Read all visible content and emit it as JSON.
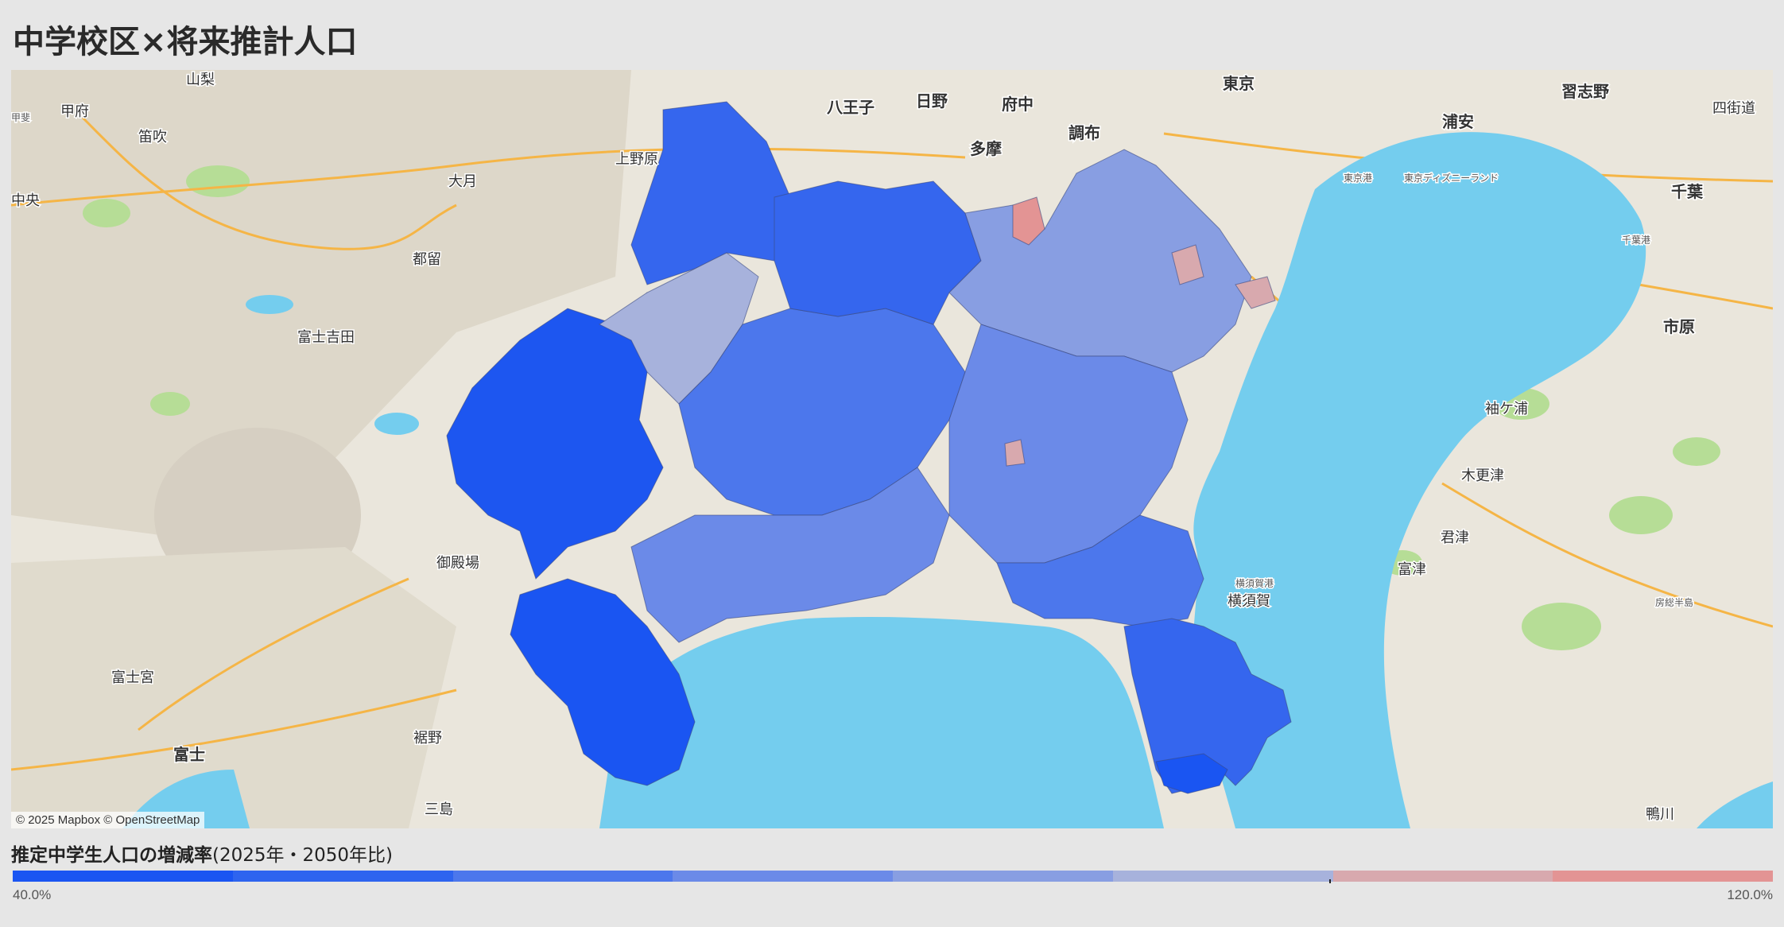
{
  "title": "中学校区×将来推計人口",
  "map": {
    "attribution": "© 2025 Mapbox © OpenStreetMap",
    "colors": {
      "sea": "#74cdee",
      "land": "#eae6dc",
      "mountain": "#d9d4c8",
      "green": "#a8d98a",
      "road": "#f5b546"
    },
    "place_labels": [
      "山梨",
      "甲府",
      "甲斐",
      "笛吹",
      "中央",
      "大月",
      "都留",
      "富士吉田",
      "御殿場",
      "富士宮",
      "富士",
      "裾野",
      "三島",
      "上野原",
      "八王子",
      "日野",
      "府中",
      "多摩",
      "調布",
      "東京",
      "浦安",
      "習志野",
      "四街道",
      "千葉",
      "市原",
      "袖ケ浦",
      "木更津",
      "君津",
      "富津",
      "横須賀",
      "鴨川",
      "東京ディズニーランド",
      "東京港",
      "千葉港",
      "横須賀港",
      "房総半島"
    ]
  },
  "legend": {
    "title_bold": "推定中学生人口の増減率",
    "title_suffix": "(2025年・2050年比)",
    "min_label": "40.0%",
    "max_label": "120.0%",
    "colors": [
      "#1a55f2",
      "#2e64ef",
      "#4c77ec",
      "#6b8ae8",
      "#889ee2",
      "#a7b2dc",
      "#d8a9ae",
      "#e39494"
    ]
  }
}
